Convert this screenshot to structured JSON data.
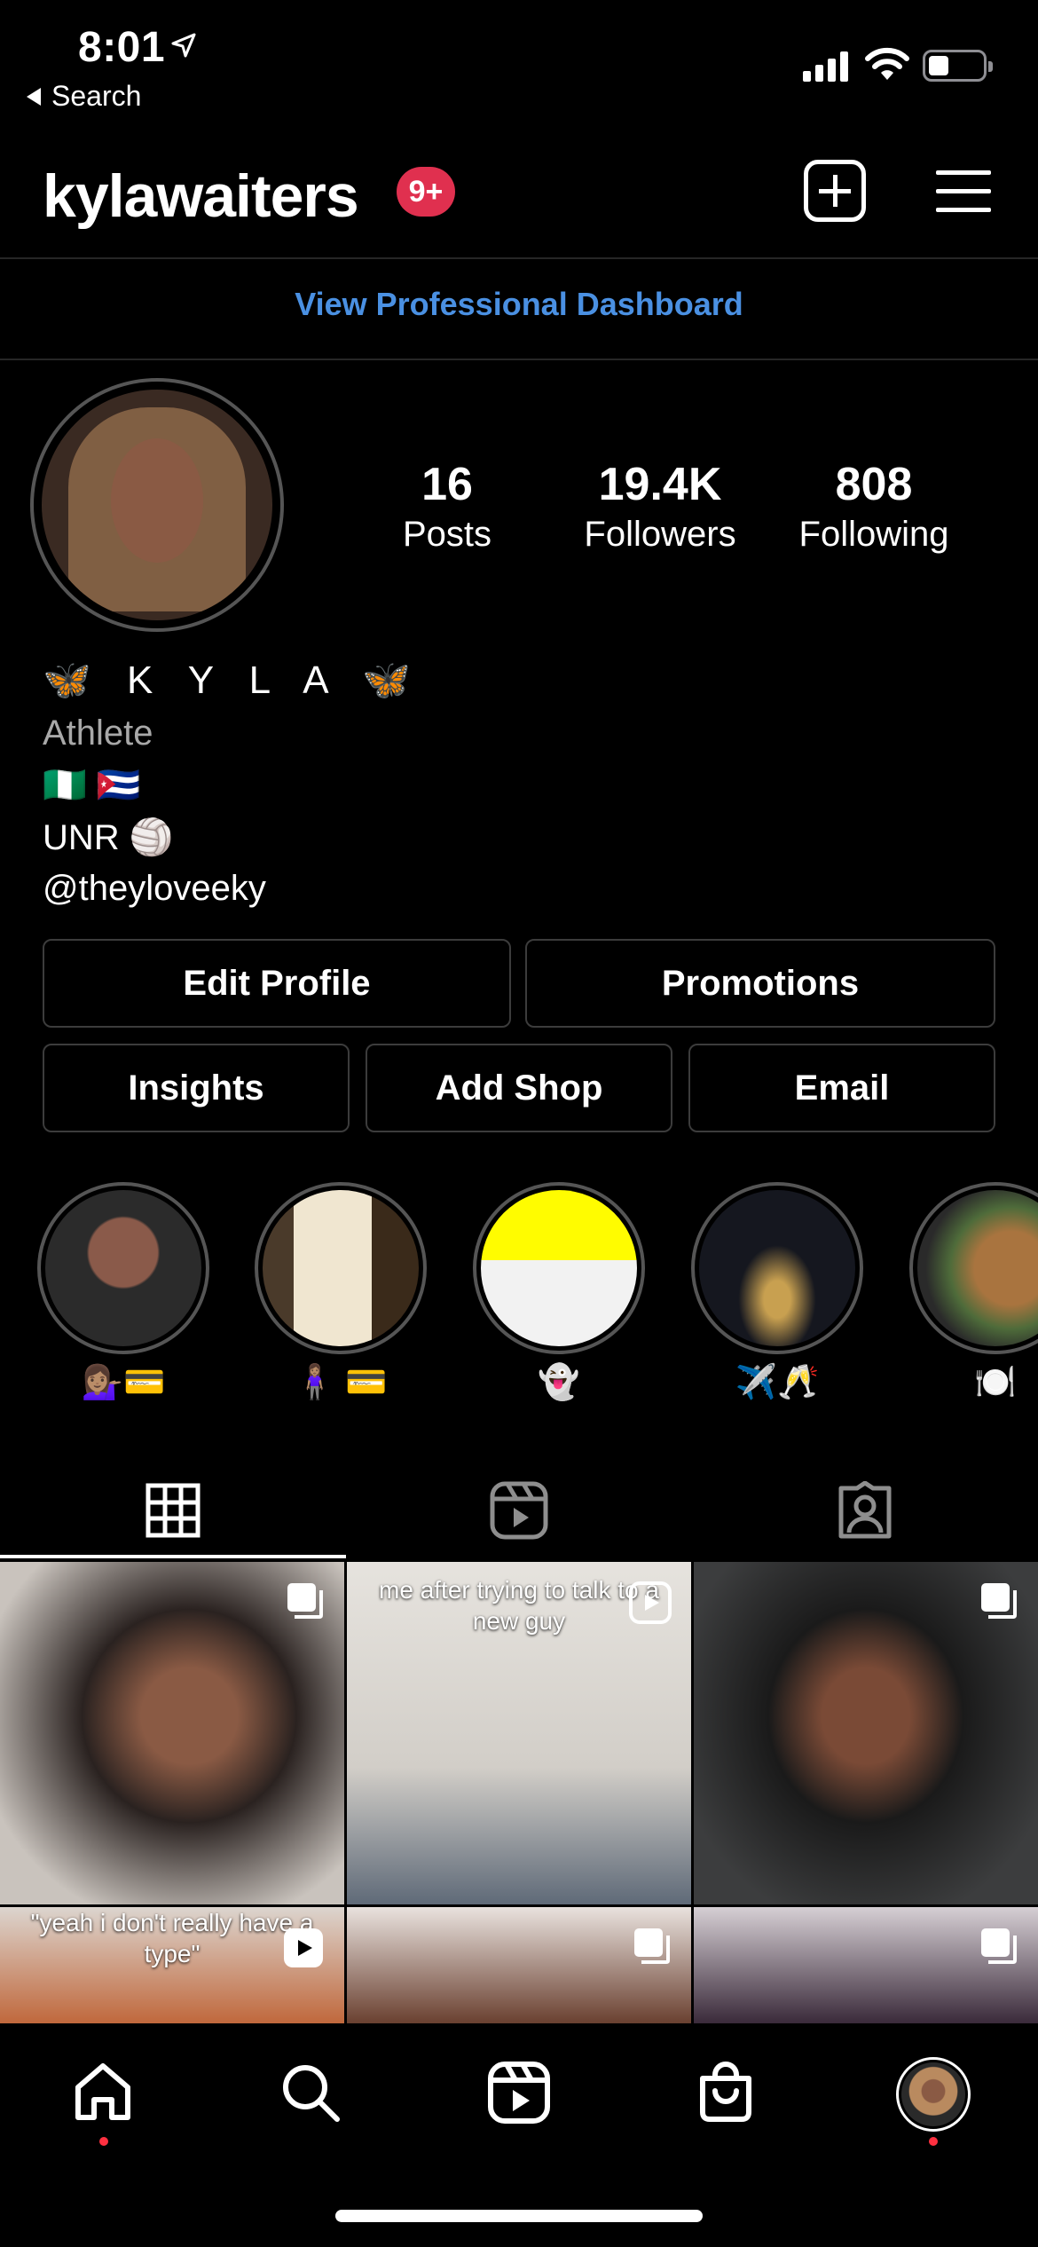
{
  "status_bar": {
    "time": "8:01",
    "back_label": "Search"
  },
  "header": {
    "username": "kylawaiters",
    "badge": "9+"
  },
  "dashboard_link": "View Professional Dashboard",
  "stats": [
    {
      "value": "16",
      "label": "Posts"
    },
    {
      "value": "19.4K",
      "label": "Followers"
    },
    {
      "value": "808",
      "label": "Following"
    }
  ],
  "bio": {
    "name": "🦋 K Y L A 🦋",
    "category": "Athlete",
    "flags": "🇳🇬 🇨🇺",
    "school": "UNR 🏐",
    "handle": "@theyloveeky"
  },
  "buttons": {
    "edit_profile": "Edit Profile",
    "promotions": "Promotions",
    "insights": "Insights",
    "add_shop": "Add Shop",
    "email": "Email"
  },
  "highlights": [
    {
      "caption": "💁🏽‍♀️💳"
    },
    {
      "caption": "🧍🏽‍♀️ 💳"
    },
    {
      "caption": "👻"
    },
    {
      "caption": "✈️🥂"
    },
    {
      "caption": "🍽️"
    }
  ],
  "tabs": [
    "grid-tab",
    "reels-tab",
    "tagged-tab"
  ],
  "posts": [
    {
      "caption": ""
    },
    {
      "caption": "me after trying to talk to a new guy"
    },
    {
      "caption": ""
    },
    {
      "caption": "\"yeah i don't really have a type\""
    },
    {
      "caption": ""
    },
    {
      "caption": ""
    }
  ],
  "colors": {
    "accent_link": "#4a90e2",
    "badge": "#e0304f",
    "nav_dot": "#ff3040"
  }
}
